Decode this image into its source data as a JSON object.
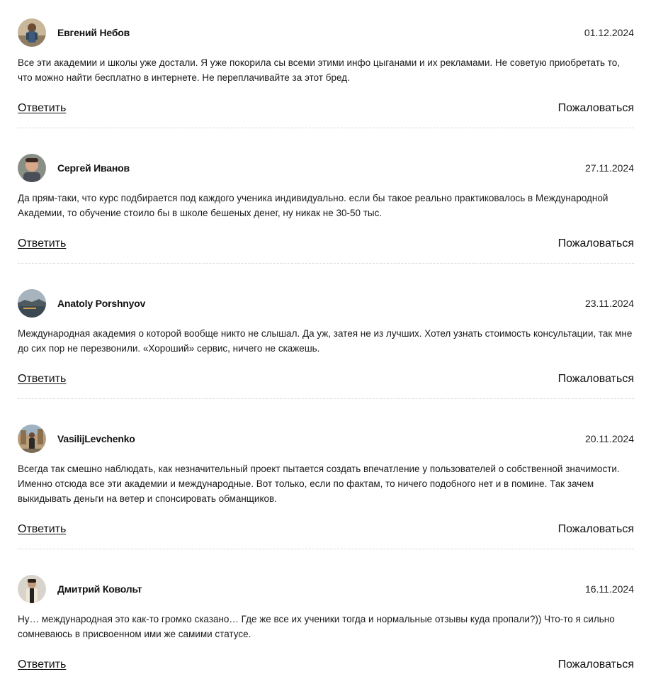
{
  "reviews": [
    {
      "author": "Евгений Небов",
      "date": "01.12.2024",
      "text": "Все эти академии и школы уже достали. Я уже покорила сы всеми этими инфо цыганами и их рекламами. Не советую приобретать то, что можно найти бесплатно в интернете. Не переплачивайте за этот бред.",
      "reply_label": "Ответить",
      "complain_label": "Пожаловаться",
      "avatar_icon": "user-photo-avatar"
    },
    {
      "author": "Сергей Иванов",
      "date": "27.11.2024",
      "text": "Да прям-таки, что курс подбирается под каждого ученика индивидуально. если бы такое реально практиковалось в Международной Академии, то обучение стоило бы в школе бешеных денег, ну никак не 30-50 тыс.",
      "reply_label": "Ответить",
      "complain_label": "Пожаловаться",
      "avatar_icon": "user-photo-avatar"
    },
    {
      "author": "Anatoly Porshnyov",
      "date": "23.11.2024",
      "text": "Международная академия о которой вообще никто не слышал. Да уж, затея не из лучших. Хотел узнать стоимость консультации, так мне до сих пор не перезвонили. «Хороший» сервис, ничего не скажешь.",
      "reply_label": "Ответить",
      "complain_label": "Пожаловаться",
      "avatar_icon": "landscape-photo-avatar"
    },
    {
      "author": "VasilijLevchenko",
      "date": "20.11.2024",
      "text": "Всегда так смешно наблюдать, как незначительный проект пытается создать впечатление у пользователей о собственной значимости. Именно отсюда все эти академии и международные. Вот только, если по фактам, то ничего подобного нет и в помине. Так зачем выкидывать деньги на ветер и спонсировать обманщиков.",
      "reply_label": "Ответить",
      "complain_label": "Пожаловаться",
      "avatar_icon": "user-photo-avatar"
    },
    {
      "author": "Дмитрий Ковольт",
      "date": "16.11.2024",
      "text": "Ну… международная это как-то громко сказано… Где же все их ученики тогда и нормальные отзывы куда пропали?)) Что-то я сильно сомневаюсь в присвоенном ими же самими статусе.",
      "reply_label": "Ответить",
      "complain_label": "Пожаловаться",
      "avatar_icon": "user-photo-avatar"
    }
  ]
}
